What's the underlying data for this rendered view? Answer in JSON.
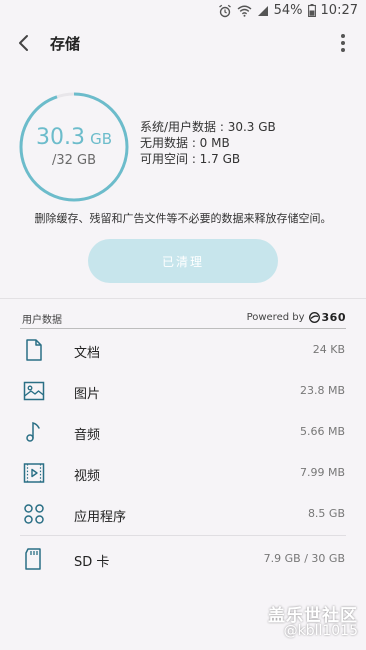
{
  "status_bar": {
    "battery_percent": "54%",
    "time": "10:27"
  },
  "appbar": {
    "title": "存储"
  },
  "storage": {
    "used_value": "30.3",
    "used_unit": "GB",
    "total": "/32 GB",
    "used_fraction": 0.947,
    "system_user_data": "系统/用户数据 : 30.3 GB",
    "unused_data": "无用数据 : 0 MB",
    "available_space": "可用空间 : 1.7 GB",
    "description": "删除缓存、残留和广告文件等不必要的数据来释放存储空间。",
    "clean_button": "已清理"
  },
  "user_data": {
    "header": "用户数据",
    "powered_by": "Powered by",
    "powered_brand": "360",
    "items": [
      {
        "label": "文档",
        "size": "24 KB",
        "icon": "document-icon"
      },
      {
        "label": "图片",
        "size": "23.8 MB",
        "icon": "image-icon"
      },
      {
        "label": "音频",
        "size": "5.66 MB",
        "icon": "music-note-icon"
      },
      {
        "label": "视频",
        "size": "7.99 MB",
        "icon": "video-icon"
      },
      {
        "label": "应用程序",
        "size": "8.5 GB",
        "icon": "apps-icon"
      },
      {
        "label": "SD 卡",
        "size": "7.9 GB / 30 GB",
        "icon": "sd-card-icon"
      }
    ]
  },
  "watermark": {
    "line1": "盖乐世社区",
    "line2": "@kbll1015"
  },
  "colors": {
    "accent": "#6cbccb",
    "ring_track": "#e8e6ea",
    "button_bg": "#c7e5ec",
    "background": "#f6f4f7"
  }
}
